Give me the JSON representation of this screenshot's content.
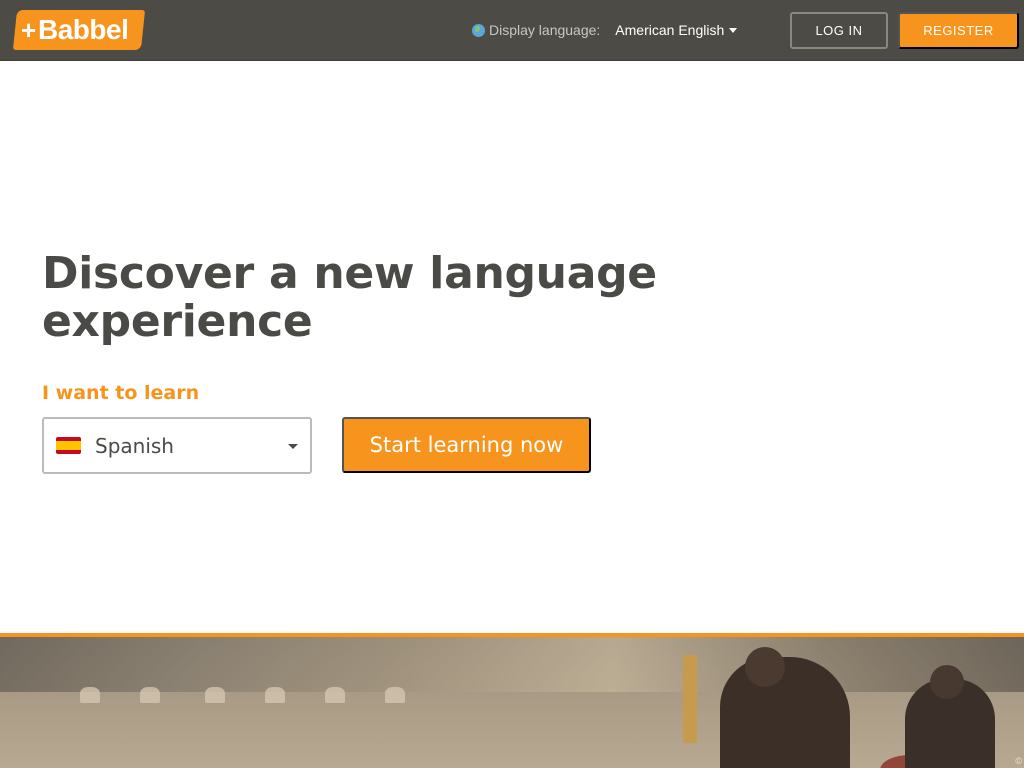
{
  "header": {
    "logo_plus": "+",
    "logo_text": "Babbel",
    "display_language_label": "Display language:",
    "display_language_value": "American English",
    "login_label": "LOG IN",
    "register_label": "REGISTER"
  },
  "hero": {
    "title": "Discover a new language experience",
    "learn_label": "I want to learn",
    "selected_language": "Spanish",
    "start_button_label": "Start learning now"
  },
  "photo": {
    "copyright": "©"
  },
  "icons": {
    "globe": "globe-icon",
    "caret": "chevron-down-icon",
    "flag": "spain-flag-icon"
  },
  "colors": {
    "brand_orange": "#f7941d",
    "header_bg": "#4d4b45",
    "text_dark": "#4a4a46"
  }
}
